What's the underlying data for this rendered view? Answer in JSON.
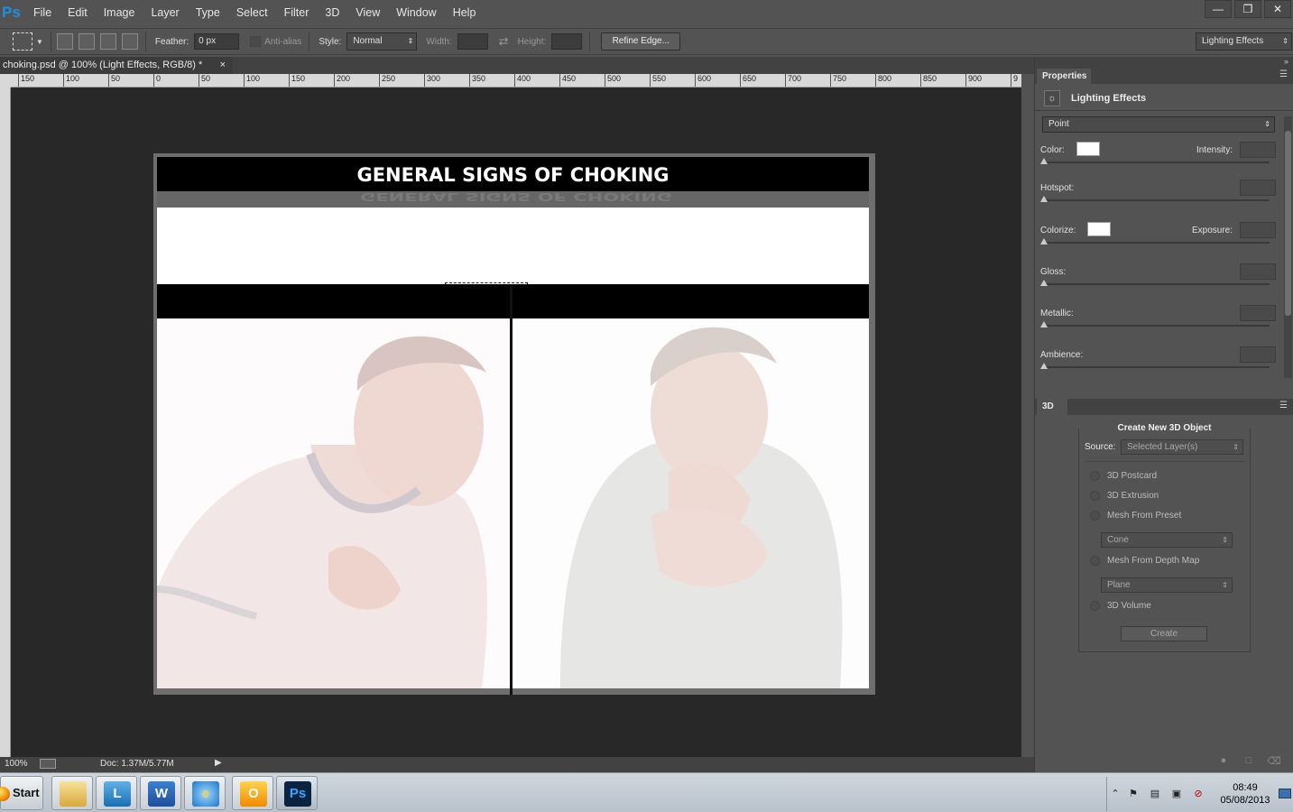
{
  "app": {
    "logo": "Ps"
  },
  "menu": [
    "File",
    "Edit",
    "Image",
    "Layer",
    "Type",
    "Select",
    "Filter",
    "3D",
    "View",
    "Window",
    "Help"
  ],
  "options": {
    "feather_label": "Feather:",
    "feather_value": "0 px",
    "antialias_label": "Anti-alias",
    "style_label": "Style:",
    "style_value": "Normal",
    "width_label": "Width:",
    "height_label": "Height:",
    "refine_edge": "Refine Edge...",
    "workspace": "Lighting Effects"
  },
  "document": {
    "tab_title": "choking.psd @ 100% (Light Effects, RGB/8) *",
    "heading": "GENERAL SIGNS OF CHOKING",
    "heading_reflection": "GENERAL SIGNS OF CHOKING"
  },
  "ruler": {
    "labels": [
      "150",
      "100",
      "50",
      "0",
      "50",
      "100",
      "150",
      "200",
      "250",
      "300",
      "350",
      "400",
      "450",
      "500",
      "550",
      "600",
      "650",
      "700",
      "750",
      "800",
      "850",
      "900",
      "9"
    ]
  },
  "properties": {
    "tab": "Properties",
    "title": "Lighting Effects",
    "light_type": "Point",
    "color_label": "Color:",
    "intensity_label": "Intensity:",
    "hotspot_label": "Hotspot:",
    "colorize_label": "Colorize:",
    "exposure_label": "Exposure:",
    "gloss_label": "Gloss:",
    "metallic_label": "Metallic:",
    "ambience_label": "Ambience:"
  },
  "panel3d": {
    "tab": "3D",
    "header": "Create New 3D Object",
    "source_label": "Source:",
    "source_value": "Selected Layer(s)",
    "opt_postcard": "3D Postcard",
    "opt_extrusion": "3D Extrusion",
    "opt_mesh_preset": "Mesh From Preset",
    "mesh_preset_value": "Cone",
    "opt_depth_map": "Mesh From Depth Map",
    "depth_map_value": "Plane",
    "opt_volume": "3D Volume",
    "create": "Create"
  },
  "status": {
    "zoom": "100%",
    "doc": "Doc: 1.37M/5.77M"
  },
  "taskbar": {
    "start": "Start",
    "time": "08:49",
    "date": "05/08/2013"
  },
  "icons": {
    "photoshop": "ps-icon",
    "word": "word-icon",
    "ie": "ie-icon",
    "outlook": "outlook-icon",
    "explorer": "folder-icon",
    "lync": "lync-icon"
  },
  "colors": {
    "ps_blue": "#1f8fe0",
    "canvas_bg": "#282828",
    "panel_bg": "#535353"
  }
}
